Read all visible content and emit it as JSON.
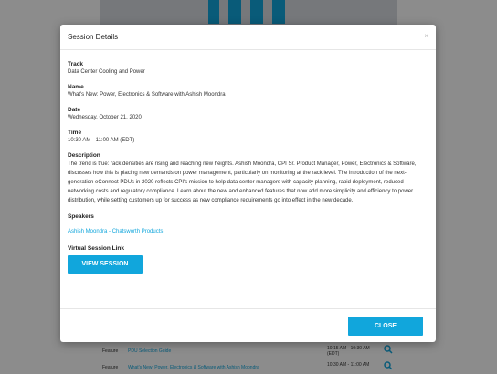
{
  "modal": {
    "title": "Session Details",
    "close_icon": "×",
    "track_label": "Track",
    "track_value": "Data Center Cooling and Power",
    "name_label": "Name",
    "name_value": "What's New: Power, Electronics & Software with Ashish Moondra",
    "date_label": "Date",
    "date_value": "Wednesday, October 21, 2020",
    "time_label": "Time",
    "time_value": "10:30 AM - 11:00 AM (EDT)",
    "description_label": "Description",
    "description_value": "The trend is true: rack densities are rising and reaching new heights. Ashish Moondra, CPI Sr. Product Manager, Power, Electronics & Software, discusses how this is placing new demands on power management, particularly on monitoring at the rack level. The introduction of the next-generation eConnect PDUs in 2020 reflects CPI's mission to help data center managers with capacity planning, rapid deployment, reduced networking costs and regulatory compliance. Learn about the new and enhanced features that now add more simplicity and efficiency to power distribution, while setting customers up for success as new compliance requirements go into effect in the new decade.",
    "speakers_label": "Speakers",
    "speakers_value": "Ashish Moondra - Chatsworth Products",
    "virtual_link_label": "Virtual Session Link",
    "view_button": "VIEW SESSION",
    "close_button": "CLOSE"
  },
  "background": {
    "rows": [
      {
        "type": "Feature",
        "title": "PDU Selection Guide",
        "time": "10:15 AM - 10:30 AM (EDT)"
      },
      {
        "type": "Feature",
        "title": "What's New: Power, Electronics & Software with Ashish Moondra",
        "time": "10:30 AM - 11:00 AM"
      }
    ]
  },
  "colors": {
    "accent": "#11a6dc"
  }
}
